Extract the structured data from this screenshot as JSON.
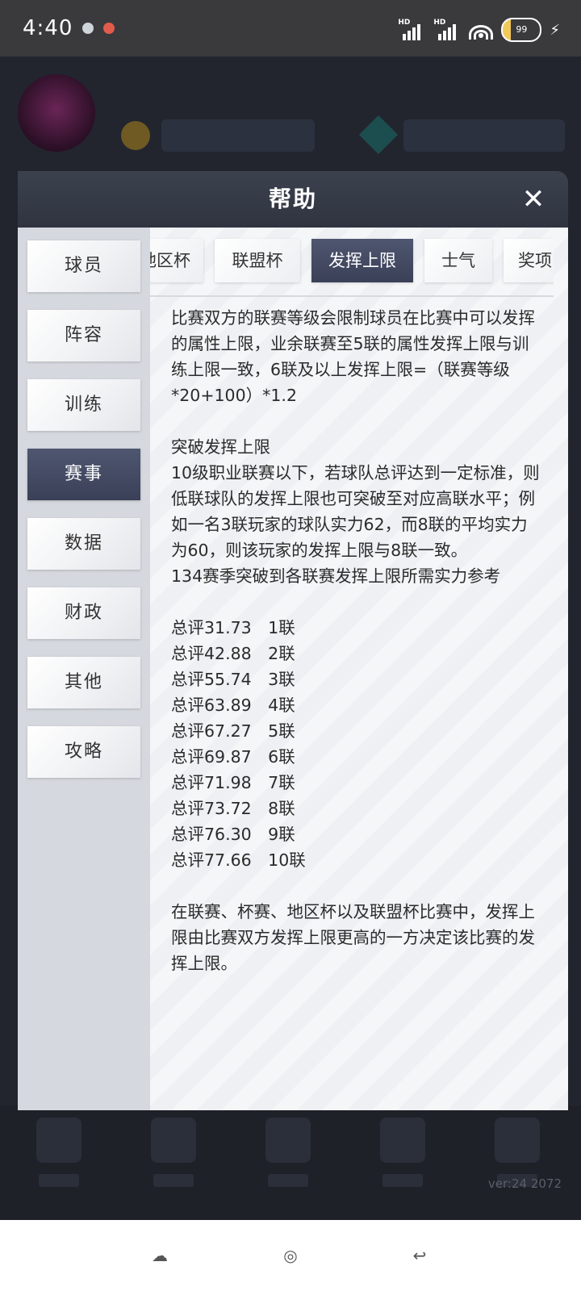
{
  "status_bar": {
    "time": "4:40",
    "net1": "HD",
    "net2": "HD",
    "battery_label": "99",
    "bolt": "⚡"
  },
  "modal": {
    "title": "帮助",
    "close_glyph": "✕"
  },
  "sidebar": {
    "items": [
      {
        "label": "球员"
      },
      {
        "label": "阵容"
      },
      {
        "label": "训练"
      },
      {
        "label": "赛事"
      },
      {
        "label": "数据"
      },
      {
        "label": "财政"
      },
      {
        "label": "其他"
      },
      {
        "label": "攻略"
      }
    ],
    "active": "赛事"
  },
  "tabs": {
    "items": [
      {
        "label": "地区杯"
      },
      {
        "label": "联盟杯"
      },
      {
        "label": "发挥上限"
      },
      {
        "label": "士气"
      },
      {
        "label": "奖项"
      }
    ],
    "active": "发挥上限"
  },
  "content": {
    "intro": "比赛双方的联赛等级会限制球员在比赛中可以发挥的属性上限，业余联赛至5联的属性发挥上限与训练上限一致，6联及以上发挥上限=（联赛等级*20+100）*1.2",
    "breakthrough_title": "突破发挥上限",
    "breakthrough_text": "10级职业联赛以下，若球队总评达到一定标准，则低联球队的发挥上限也可突破至对应高联水平；例如一名3联玩家的球队实力62，而8联的平均实力为60，则该玩家的发挥上限与8联一致。",
    "season_ref": "134赛季突破到各联赛发挥上限所需实力参考",
    "thresholds": [
      "总评31.73　1联",
      "总评42.88　2联",
      "总评55.74　3联",
      "总评63.89　4联",
      "总评67.27　5联",
      "总评69.87　6联",
      "总评71.98　7联",
      "总评73.72　8联",
      "总评76.30　9联",
      "总评77.66　10联"
    ],
    "closing": "在联赛、杯赛、地区杯以及联盟杯比赛中，发挥上限由比赛双方发挥上限更高的一方决定该比赛的发挥上限。"
  },
  "footer": {
    "version": "ver:24  2072"
  },
  "icons": {
    "status": [
      "chat-bubble-icon",
      "app-notification-icon",
      "signal-icon",
      "wifi-icon",
      "battery-icon"
    ],
    "system_nav": [
      "assistant-icon",
      "home-icon",
      "back-icon"
    ]
  },
  "colors": {
    "active_tab": "#3f4660",
    "header": "#343946",
    "content_bg": "#f2f3f5"
  }
}
